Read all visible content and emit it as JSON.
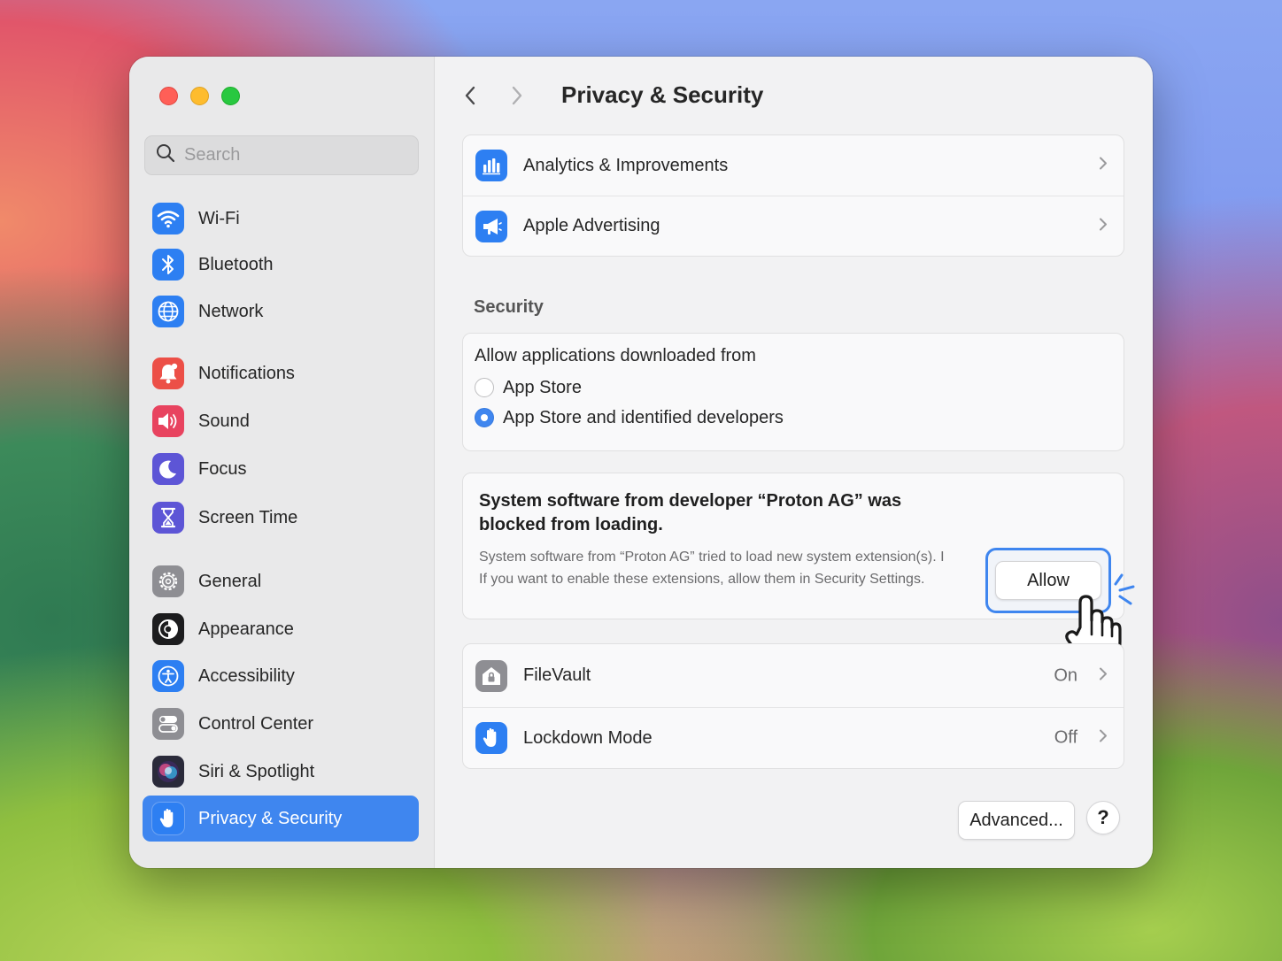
{
  "window": {
    "title": "Privacy & Security"
  },
  "search": {
    "placeholder": "Search"
  },
  "sidebar": {
    "items": [
      {
        "label": "Wi-Fi",
        "icon": "wifi-icon",
        "color": "#2d7ff2"
      },
      {
        "label": "Bluetooth",
        "icon": "bluetooth-icon",
        "color": "#2d7ff2"
      },
      {
        "label": "Network",
        "icon": "globe-icon",
        "color": "#2d7ff2"
      },
      {
        "label": "Notifications",
        "icon": "bell-icon",
        "color": "#ec4f47"
      },
      {
        "label": "Sound",
        "icon": "speaker-icon",
        "color": "#e8435f"
      },
      {
        "label": "Focus",
        "icon": "moon-icon",
        "color": "#5d55d6"
      },
      {
        "label": "Screen Time",
        "icon": "hourglass-icon",
        "color": "#5d55d6"
      },
      {
        "label": "General",
        "icon": "gear-icon",
        "color": "#8e8e93"
      },
      {
        "label": "Appearance",
        "icon": "appearance-icon",
        "color": "#1c1c1e"
      },
      {
        "label": "Accessibility",
        "icon": "accessibility-icon",
        "color": "#2d7ff2"
      },
      {
        "label": "Control Center",
        "icon": "toggles-icon",
        "color": "#8e8e93"
      },
      {
        "label": "Siri & Spotlight",
        "icon": "siri-icon",
        "color": "#2a2a3a"
      },
      {
        "label": "Privacy & Security",
        "icon": "hand-icon",
        "color": "#2d7ff2",
        "selected": true
      }
    ]
  },
  "main": {
    "top_rows": [
      {
        "label": "Analytics & Improvements",
        "icon": "bar-chart-icon"
      },
      {
        "label": "Apple Advertising",
        "icon": "megaphone-icon"
      }
    ],
    "security": {
      "section_label": "Security",
      "allow_from_label": "Allow applications downloaded from",
      "options": [
        {
          "label": "App Store",
          "selected": false
        },
        {
          "label": "App Store and identified developers",
          "selected": true
        }
      ]
    },
    "alert": {
      "title": "System software from developer “Proton AG” was blocked from loading.",
      "body_line1": "System software from “Proton AG” tried to load new system extension(s). I",
      "body_line2": "If you want to enable these extensions, allow them in Security Settings.",
      "allow_label": "Allow"
    },
    "bottom_rows": [
      {
        "label": "FileVault",
        "value": "On",
        "icon": "house-lock-icon"
      },
      {
        "label": "Lockdown Mode",
        "value": "Off",
        "icon": "hand-icon"
      }
    ],
    "advanced_label": "Advanced...",
    "help_label": "?"
  },
  "colors": {
    "accent": "#3f86ef",
    "selected_row": "#3f86ef",
    "window_bg": "#f2f2f3",
    "sidebar_bg": "#e9e9ea"
  }
}
